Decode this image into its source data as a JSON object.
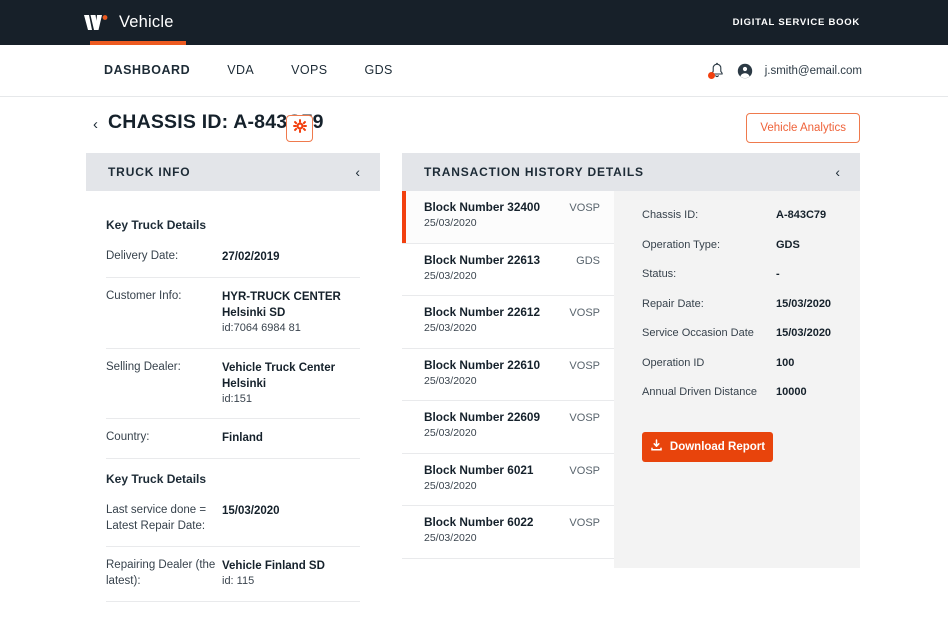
{
  "topbar": {
    "brand_name": "Vehicle",
    "right_label": "DIGITAL SERVICE BOOK",
    "logo_icon": "vehicle-w-logo",
    "accent_color": "#ed5a20"
  },
  "nav": {
    "items": [
      {
        "label": "DASHBOARD",
        "active": true
      },
      {
        "label": "VDA",
        "active": false
      },
      {
        "label": "VOPS",
        "active": false
      },
      {
        "label": "GDS",
        "active": false
      }
    ],
    "bell_icon": "notification-bell-icon",
    "account_icon": "account-circle-icon",
    "account_email": "j.smith@email.com"
  },
  "pagehead": {
    "back_icon": "chevron-left-icon",
    "title": "CHASSIS ID: A-843C79",
    "settings_icon": "gear-icon",
    "analytics_button": "Vehicle Analytics"
  },
  "truck_info": {
    "panel_title": "TRUCK INFO",
    "collapse_icon": "chevron-left-icon",
    "sections": [
      {
        "title": "Key Truck Details",
        "rows": [
          {
            "key": "Delivery Date:",
            "value": "27/02/2019",
            "sub": ""
          },
          {
            "key": "Customer Info:",
            "value": "HYR-TRUCK CENTER Helsinki SD",
            "sub": "id:7064 6984 81"
          },
          {
            "key": "Selling Dealer:",
            "value": "Vehicle Truck Center Helsinki",
            "sub": "id:151"
          },
          {
            "key": "Country:",
            "value": "Finland",
            "sub": ""
          }
        ]
      },
      {
        "title": "Key Truck Details",
        "rows": [
          {
            "key": "Last service done = Latest Repair Date:",
            "value": "15/03/2020",
            "sub": ""
          },
          {
            "key": "Repairing Dealer (the latest):",
            "value": "Vehicle Finland SD",
            "sub": "id: 115"
          }
        ]
      }
    ]
  },
  "transaction_history": {
    "panel_title": "TRANSACTION HISTORY DETAILS",
    "collapse_icon": "chevron-left-icon",
    "items": [
      {
        "name": "Block Number 32400",
        "type": "VOSP",
        "date": "25/03/2020",
        "selected": true
      },
      {
        "name": "Block Number 22613",
        "type": "GDS",
        "date": "25/03/2020",
        "selected": false
      },
      {
        "name": "Block Number 22612",
        "type": "VOSP",
        "date": "25/03/2020",
        "selected": false
      },
      {
        "name": "Block Number 22610",
        "type": "VOSP",
        "date": "25/03/2020",
        "selected": false
      },
      {
        "name": "Block Number 22609",
        "type": "VOSP",
        "date": "25/03/2020",
        "selected": false
      },
      {
        "name": "Block Number 6021",
        "type": "VOSP",
        "date": "25/03/2020",
        "selected": false
      },
      {
        "name": "Block Number 6022",
        "type": "VOSP",
        "date": "25/03/2020",
        "selected": false
      }
    ],
    "detail_rows": [
      {
        "key": "Chassis ID:",
        "value": "A-843C79"
      },
      {
        "key": "Operation Type:",
        "value": "GDS"
      },
      {
        "key": "Status:",
        "value": "-"
      },
      {
        "key": "Repair Date:",
        "value": "15/03/2020"
      },
      {
        "key": "Service Occasion Date",
        "value": "15/03/2020"
      },
      {
        "key": "Operation ID",
        "value": "100"
      },
      {
        "key": "Annual Driven Distance",
        "value": "10000"
      }
    ],
    "download_button": "Download Report",
    "download_icon": "download-icon"
  }
}
